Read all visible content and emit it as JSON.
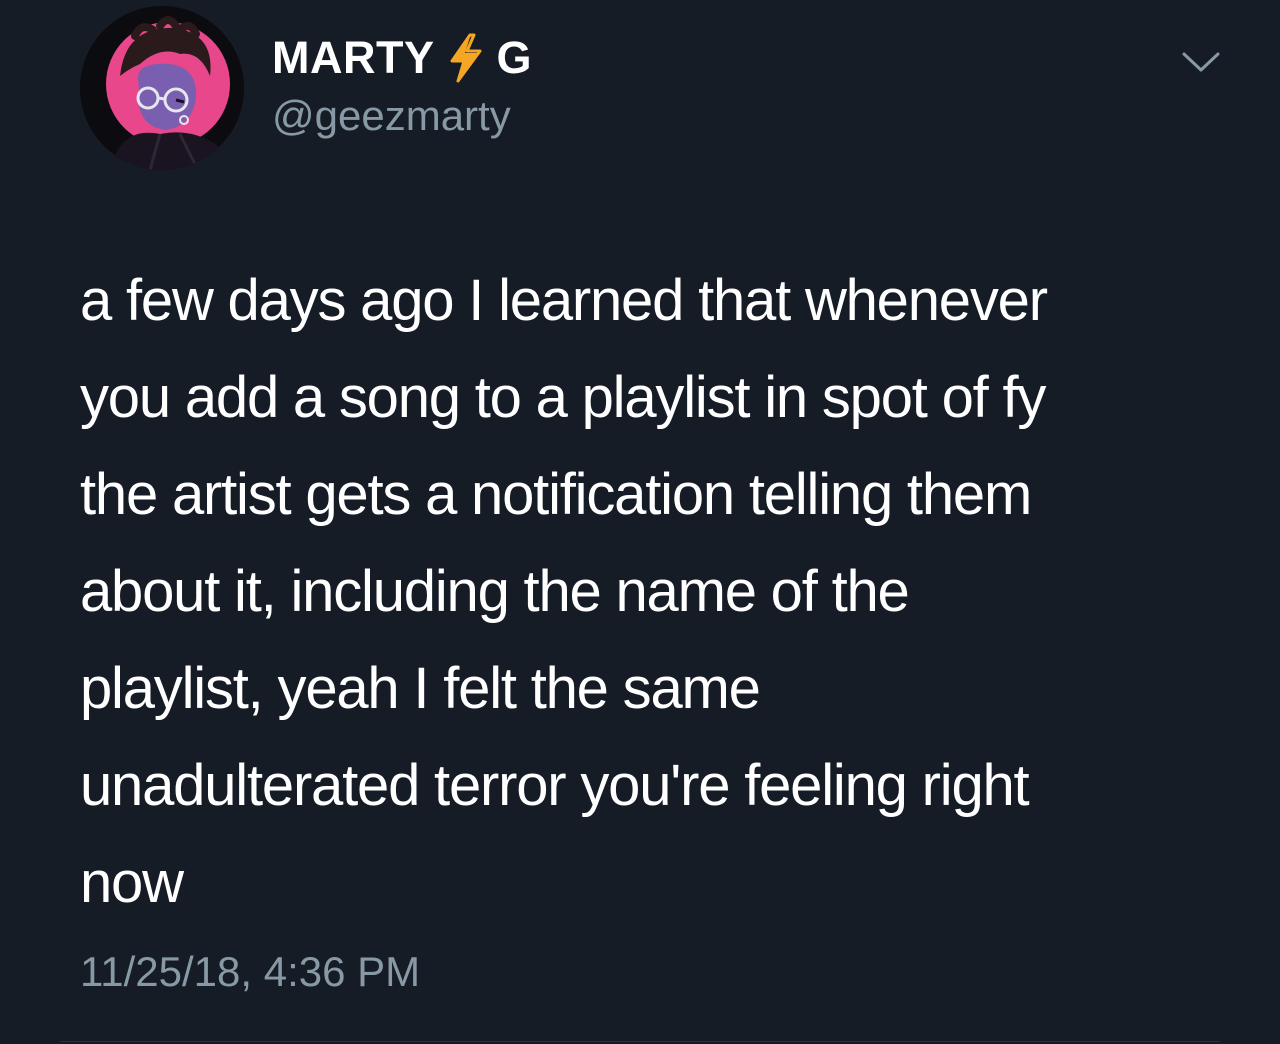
{
  "tweet": {
    "display_name_part1": "MARTY",
    "display_name_part2": "G",
    "name_emoji": "lightning-bolt-icon",
    "handle": "@geezmarty",
    "text": "a few days ago I learned that whenever\nyou add a song to a playlist in spot of fy\nthe artist gets a notification telling them\nabout it, including the name of the\nplaylist, yeah I felt the same\nunadulterated terror you're feeling right\nnow",
    "timestamp": "11/25/18, 4:36 PM",
    "menu_icon": "chevron-down-icon"
  },
  "colors": {
    "background": "#161c26",
    "primary_text": "#ffffff",
    "secondary_text": "#8899a6",
    "bolt": "#f5a623",
    "avatar_ring": "#e8478b"
  }
}
